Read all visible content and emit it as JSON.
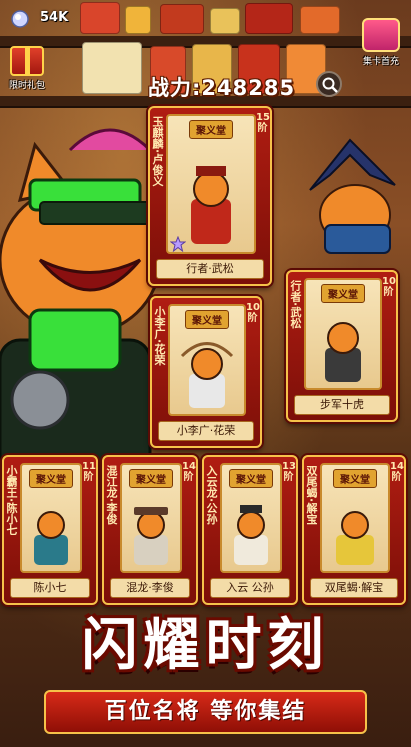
{
  "topbar": {
    "currency_value": "54K",
    "gift_label": "限时礼包",
    "cardpack_label": "集卡首充"
  },
  "power": {
    "text": "战力:248285"
  },
  "cards": [
    {
      "hall": "聚义堂",
      "vertical_name": "玉麒麟·卢俊义",
      "level": "15阶",
      "footer": "行者·武松"
    },
    {
      "hall": "聚义堂",
      "vertical_name": "行者·武松",
      "level": "10阶",
      "footer": "步军十虎"
    },
    {
      "hall": "聚义堂",
      "vertical_name": "小李广·花荣",
      "level": "10阶",
      "footer": "小李广·花荣"
    },
    {
      "hall": "聚义堂",
      "vertical_name": "小霸王·陈小七",
      "level": "11阶",
      "footer": "陈小七"
    },
    {
      "hall": "聚义堂",
      "vertical_name": "混江龙·李俊",
      "level": "14阶",
      "footer": "混龙·李俊"
    },
    {
      "hall": "聚义堂",
      "vertical_name": "入云龙·公孙",
      "level": "13阶",
      "footer": "入云 公孙"
    },
    {
      "hall": "聚义堂",
      "vertical_name": "双尾蝎·解宝",
      "level": "14阶",
      "footer": "双尾蝎·解宝"
    }
  ],
  "banner": {
    "title": "闪耀时刻",
    "subtitle": "百位名将  等你集结"
  },
  "colors": {
    "card_red": "#b01d12",
    "gold_border": "#f6c24a",
    "parchment": "#f7e4b8",
    "text_dark": "#3a1806"
  }
}
